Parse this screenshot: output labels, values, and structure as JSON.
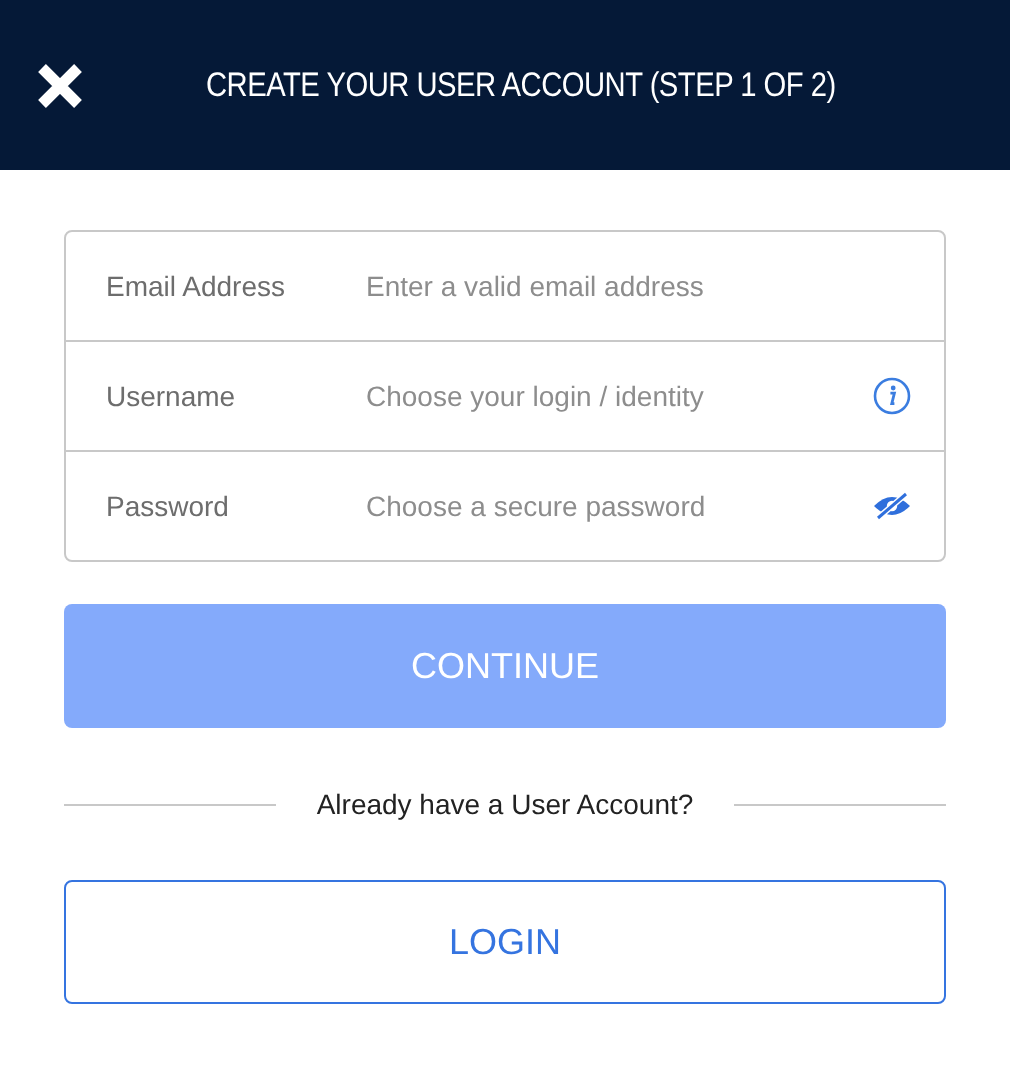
{
  "header": {
    "title": "CREATE YOUR USER ACCOUNT (STEP 1 OF 2)"
  },
  "fields": [
    {
      "label": "Email Address",
      "placeholder": "Enter a valid email address",
      "kind": "plain"
    },
    {
      "label": "Username",
      "placeholder": "Choose your login / identity",
      "kind": "info"
    },
    {
      "label": "Password",
      "placeholder": "Choose a secure password",
      "kind": "reveal"
    }
  ],
  "continue_button": {
    "label": "CONTINUE",
    "disabled": true
  },
  "divider_text": "Already have a User Account?",
  "login_button": {
    "label": "LOGIN"
  }
}
